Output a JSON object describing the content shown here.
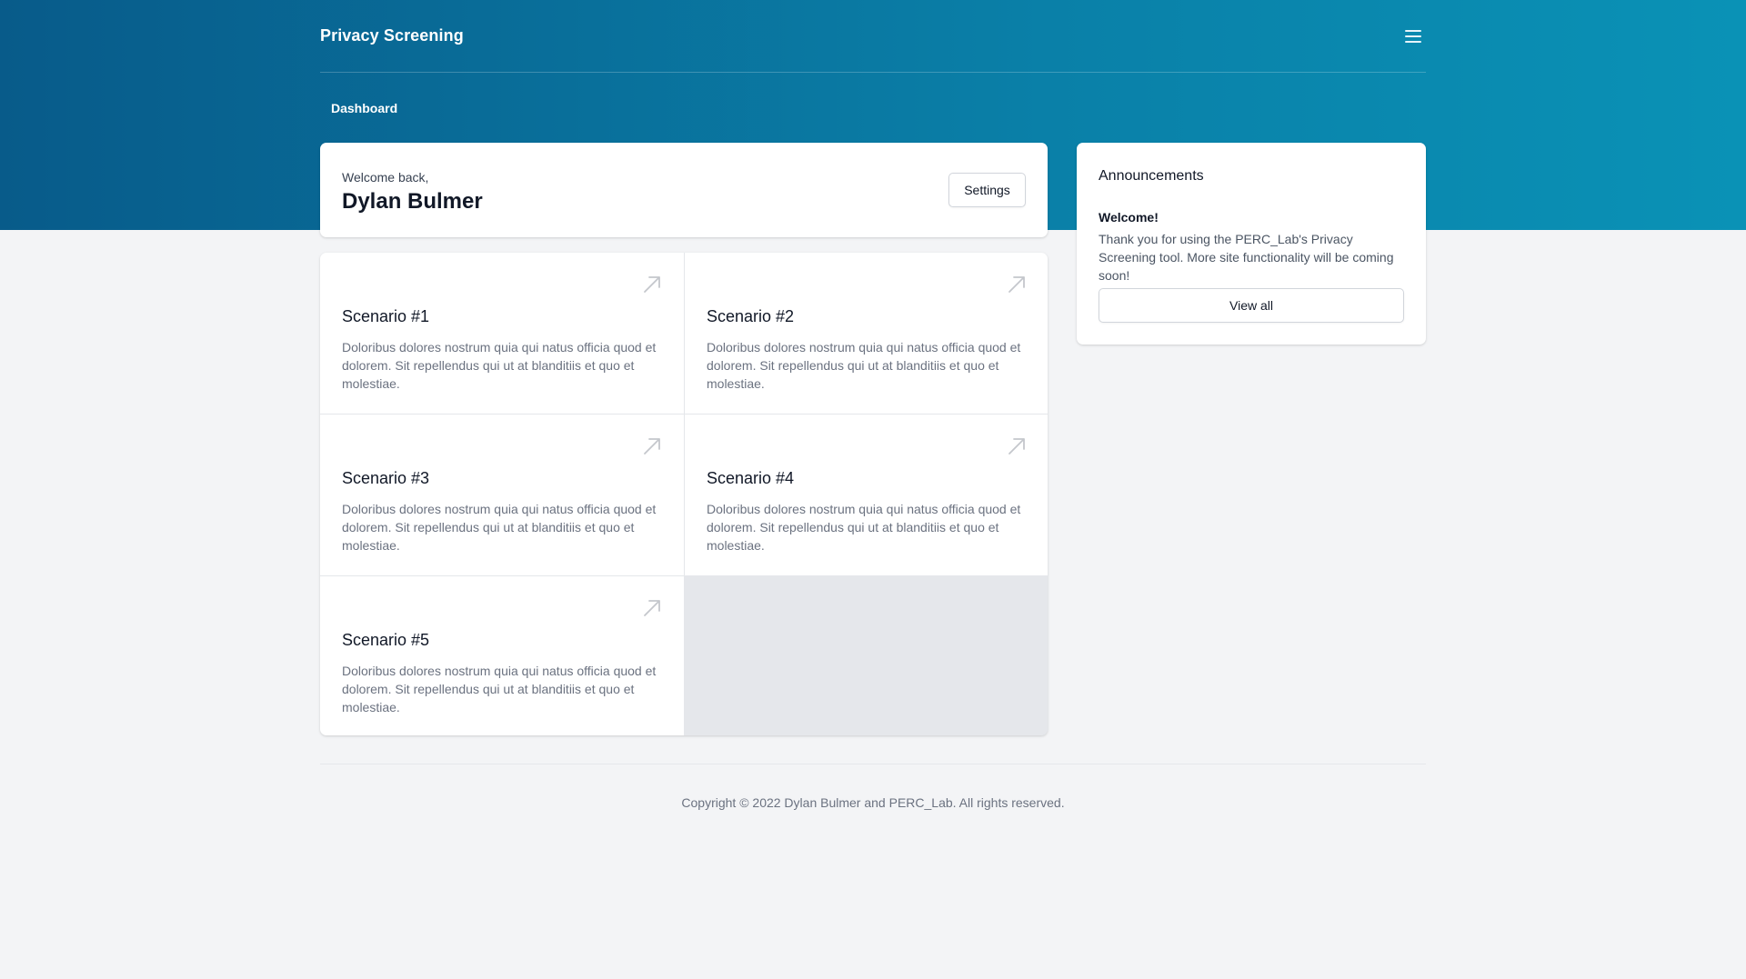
{
  "header": {
    "brand": "Privacy Screening",
    "menu_icon": "hamburger-menu-icon",
    "nav_tab": "Dashboard"
  },
  "welcome": {
    "greeting": "Welcome back,",
    "name": "Dylan Bulmer",
    "settings_label": "Settings"
  },
  "scenarios": [
    {
      "title": "Scenario #1",
      "description": "Doloribus dolores nostrum quia qui natus officia quod et dolorem. Sit repellendus qui ut at blanditiis et quo et molestiae."
    },
    {
      "title": "Scenario #2",
      "description": "Doloribus dolores nostrum quia qui natus officia quod et dolorem. Sit repellendus qui ut at blanditiis et quo et molestiae."
    },
    {
      "title": "Scenario #3",
      "description": "Doloribus dolores nostrum quia qui natus officia quod et dolorem. Sit repellendus qui ut at blanditiis et quo et molestiae."
    },
    {
      "title": "Scenario #4",
      "description": "Doloribus dolores nostrum quia qui natus officia quod et dolorem. Sit repellendus qui ut at blanditiis et quo et molestiae."
    },
    {
      "title": "Scenario #5",
      "description": "Doloribus dolores nostrum quia qui natus officia quod et dolorem. Sit repellendus qui ut at blanditiis et quo et molestiae."
    }
  ],
  "scenario_icon": "arrow-up-right-icon",
  "announcements": {
    "heading": "Announcements",
    "item_title": "Welcome!",
    "item_body": "Thank you for using the PERC_Lab's Privacy Screening tool. More site functionality will be coming soon!",
    "view_all_label": "View all"
  },
  "footer": {
    "copyright": "Copyright © 2022 Dylan Bulmer and PERC_Lab. All rights reserved."
  },
  "colors": {
    "header_gradient_start": "#085b8a",
    "header_gradient_end": "#0a92b6",
    "page_background": "#f3f4f6"
  }
}
